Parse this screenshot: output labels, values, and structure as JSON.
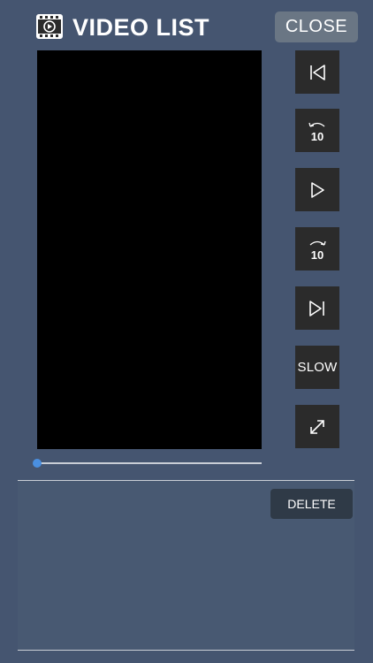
{
  "header": {
    "icon": "video-file-icon",
    "title": "VIDEO LIST",
    "close_label": "CLOSE"
  },
  "controls": {
    "skip_start_icon": "skip-to-start-icon",
    "rewind_icon": "rewind-10-icon",
    "rewind_label": "10",
    "play_icon": "play-icon",
    "forward_icon": "forward-10-icon",
    "forward_label": "10",
    "skip_end_icon": "skip-to-end-icon",
    "slow_label": "SLOW",
    "fullscreen_icon": "expand-icon"
  },
  "playback": {
    "progress": 0
  },
  "list": {
    "delete_label": "DELETE"
  },
  "colors": {
    "background": "#455570",
    "button": "#2b2b2b",
    "close_button": "#6a7684",
    "delete_button": "#2f3a47",
    "seek_thumb": "#4a8fe0"
  }
}
